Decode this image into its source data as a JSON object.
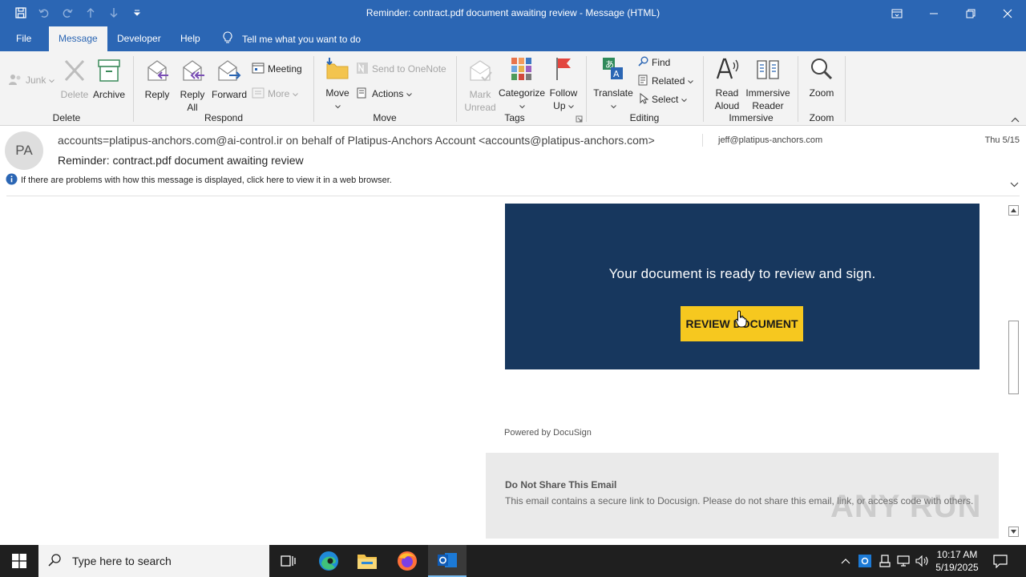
{
  "window": {
    "title": "Reminder: contract.pdf document awaiting review  -  Message (HTML)"
  },
  "tabs": [
    {
      "label": "File"
    },
    {
      "label": "Message"
    },
    {
      "label": "Developer"
    },
    {
      "label": "Help"
    }
  ],
  "tell_me": "Tell me what you want to do",
  "ribbon": {
    "delete_group": {
      "junk": "Junk",
      "delete": "Delete",
      "archive": "Archive",
      "label": "Delete"
    },
    "respond_group": {
      "reply": "Reply",
      "reply_all_1": "Reply",
      "reply_all_2": "All",
      "forward": "Forward",
      "meeting": "Meeting",
      "more": "More",
      "label": "Respond"
    },
    "move_group": {
      "move": "Move",
      "send_onenote": "Send to OneNote",
      "actions": "Actions",
      "label": "Move"
    },
    "tags_group": {
      "mark_1": "Mark",
      "mark_2": "Unread",
      "categorize": "Categorize",
      "follow_1": "Follow",
      "follow_2": "Up",
      "label": "Tags"
    },
    "editing_group": {
      "translate": "Translate",
      "find": "Find",
      "related": "Related",
      "select": "Select",
      "label": "Editing"
    },
    "immersive_group": {
      "read_1": "Read",
      "read_2": "Aloud",
      "imm_1": "Immersive",
      "imm_2": "Reader",
      "label": "Immersive"
    },
    "zoom_group": {
      "zoom": "Zoom",
      "label": "Zoom"
    }
  },
  "header": {
    "avatar": "PA",
    "from": "accounts=platipus-anchors.com@ai-control.ir on behalf of Platipus-Anchors Account <accounts@platipus-anchors.com>",
    "to": "jeff@platipus-anchors.com",
    "date": "Thu 5/15",
    "subject": "Reminder: contract.pdf document awaiting review",
    "infobar": "If there are problems with how this message is displayed, click here to view it in a web browser."
  },
  "email": {
    "banner_text": "Your document is ready to review and sign.",
    "button_label": "REVIEW DOCUMENT",
    "powered_by": "Powered by DocuSign",
    "notice_title": "Do Not Share This Email",
    "notice_text": "This email contains a secure link to Docusign. Please do not share this email, link, or access code with others."
  },
  "watermark": "ANY RUN",
  "taskbar": {
    "search_placeholder": "Type here to search",
    "time": "10:17 AM",
    "date": "5/19/2025"
  },
  "colors": {
    "accent": "#2b66b4",
    "banner": "#17375e",
    "button": "#f6c81f"
  }
}
